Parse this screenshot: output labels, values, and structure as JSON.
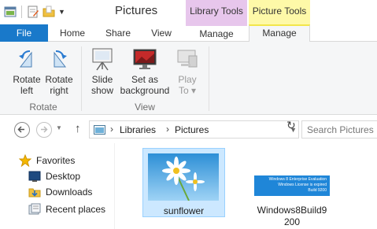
{
  "window": {
    "title": "Pictures",
    "context_tabs": [
      "Library Tools",
      "Picture Tools"
    ],
    "colors": {
      "file_tab": "#1979ca",
      "library_tools": "#e7c6ec",
      "picture_tools": "#fef9a8",
      "selection": "#cce8ff"
    }
  },
  "quick_access": {
    "icons": [
      "properties-icon",
      "new-folder-icon"
    ]
  },
  "tabs": [
    "File",
    "Home",
    "Share",
    "View",
    "Manage",
    "Manage"
  ],
  "ribbon": {
    "rotate_left": [
      "Rotate",
      "left"
    ],
    "rotate_right": [
      "Rotate",
      "right"
    ],
    "slide_show": [
      "Slide",
      "show"
    ],
    "set_background": [
      "Set as",
      "background"
    ],
    "play_to": [
      "Play",
      "To ▾"
    ],
    "groups": [
      "Rotate",
      "View"
    ]
  },
  "address": {
    "crumbs": [
      "Libraries",
      "Pictures"
    ],
    "search_placeholder": "Search Pictures"
  },
  "nav_pane": {
    "items": [
      {
        "label": "Favorites",
        "icon": "star-icon"
      },
      {
        "label": "Desktop",
        "icon": "desktop-icon"
      },
      {
        "label": "Downloads",
        "icon": "downloads-icon"
      },
      {
        "label": "Recent places",
        "icon": "recent-places-icon"
      }
    ]
  },
  "files": [
    {
      "name": "sunflower",
      "selected": true
    },
    {
      "name": "Windows8Build9",
      "name2": "200",
      "selected": false,
      "thumb_text": [
        "Windows 8 Enterprise Evaluation",
        "Windows License is expired",
        "Build 9200"
      ]
    }
  ]
}
